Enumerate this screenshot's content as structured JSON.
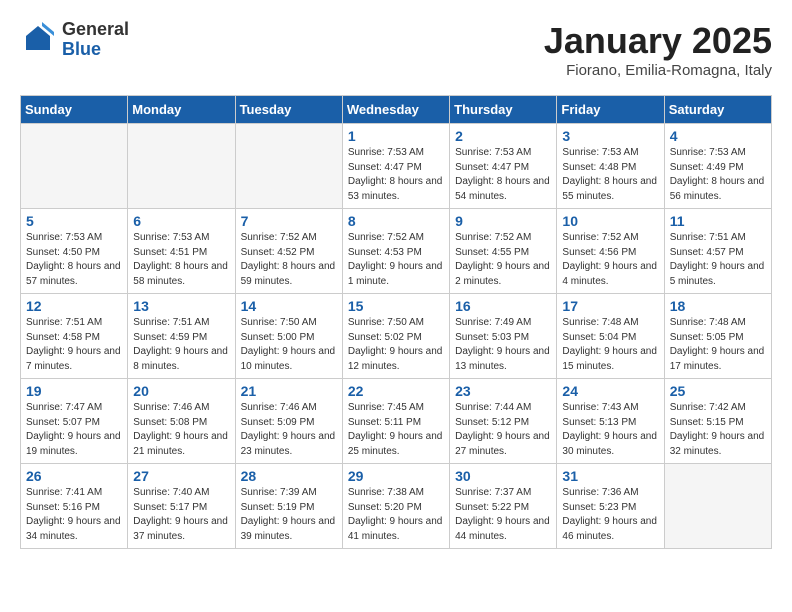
{
  "header": {
    "logo_general": "General",
    "logo_blue": "Blue",
    "title": "January 2025",
    "subtitle": "Fiorano, Emilia-Romagna, Italy"
  },
  "weekdays": [
    "Sunday",
    "Monday",
    "Tuesday",
    "Wednesday",
    "Thursday",
    "Friday",
    "Saturday"
  ],
  "weeks": [
    [
      {
        "num": "",
        "info": ""
      },
      {
        "num": "",
        "info": ""
      },
      {
        "num": "",
        "info": ""
      },
      {
        "num": "1",
        "info": "Sunrise: 7:53 AM\nSunset: 4:47 PM\nDaylight: 8 hours and 53 minutes."
      },
      {
        "num": "2",
        "info": "Sunrise: 7:53 AM\nSunset: 4:47 PM\nDaylight: 8 hours and 54 minutes."
      },
      {
        "num": "3",
        "info": "Sunrise: 7:53 AM\nSunset: 4:48 PM\nDaylight: 8 hours and 55 minutes."
      },
      {
        "num": "4",
        "info": "Sunrise: 7:53 AM\nSunset: 4:49 PM\nDaylight: 8 hours and 56 minutes."
      }
    ],
    [
      {
        "num": "5",
        "info": "Sunrise: 7:53 AM\nSunset: 4:50 PM\nDaylight: 8 hours and 57 minutes."
      },
      {
        "num": "6",
        "info": "Sunrise: 7:53 AM\nSunset: 4:51 PM\nDaylight: 8 hours and 58 minutes."
      },
      {
        "num": "7",
        "info": "Sunrise: 7:52 AM\nSunset: 4:52 PM\nDaylight: 8 hours and 59 minutes."
      },
      {
        "num": "8",
        "info": "Sunrise: 7:52 AM\nSunset: 4:53 PM\nDaylight: 9 hours and 1 minute."
      },
      {
        "num": "9",
        "info": "Sunrise: 7:52 AM\nSunset: 4:55 PM\nDaylight: 9 hours and 2 minutes."
      },
      {
        "num": "10",
        "info": "Sunrise: 7:52 AM\nSunset: 4:56 PM\nDaylight: 9 hours and 4 minutes."
      },
      {
        "num": "11",
        "info": "Sunrise: 7:51 AM\nSunset: 4:57 PM\nDaylight: 9 hours and 5 minutes."
      }
    ],
    [
      {
        "num": "12",
        "info": "Sunrise: 7:51 AM\nSunset: 4:58 PM\nDaylight: 9 hours and 7 minutes."
      },
      {
        "num": "13",
        "info": "Sunrise: 7:51 AM\nSunset: 4:59 PM\nDaylight: 9 hours and 8 minutes."
      },
      {
        "num": "14",
        "info": "Sunrise: 7:50 AM\nSunset: 5:00 PM\nDaylight: 9 hours and 10 minutes."
      },
      {
        "num": "15",
        "info": "Sunrise: 7:50 AM\nSunset: 5:02 PM\nDaylight: 9 hours and 12 minutes."
      },
      {
        "num": "16",
        "info": "Sunrise: 7:49 AM\nSunset: 5:03 PM\nDaylight: 9 hours and 13 minutes."
      },
      {
        "num": "17",
        "info": "Sunrise: 7:48 AM\nSunset: 5:04 PM\nDaylight: 9 hours and 15 minutes."
      },
      {
        "num": "18",
        "info": "Sunrise: 7:48 AM\nSunset: 5:05 PM\nDaylight: 9 hours and 17 minutes."
      }
    ],
    [
      {
        "num": "19",
        "info": "Sunrise: 7:47 AM\nSunset: 5:07 PM\nDaylight: 9 hours and 19 minutes."
      },
      {
        "num": "20",
        "info": "Sunrise: 7:46 AM\nSunset: 5:08 PM\nDaylight: 9 hours and 21 minutes."
      },
      {
        "num": "21",
        "info": "Sunrise: 7:46 AM\nSunset: 5:09 PM\nDaylight: 9 hours and 23 minutes."
      },
      {
        "num": "22",
        "info": "Sunrise: 7:45 AM\nSunset: 5:11 PM\nDaylight: 9 hours and 25 minutes."
      },
      {
        "num": "23",
        "info": "Sunrise: 7:44 AM\nSunset: 5:12 PM\nDaylight: 9 hours and 27 minutes."
      },
      {
        "num": "24",
        "info": "Sunrise: 7:43 AM\nSunset: 5:13 PM\nDaylight: 9 hours and 30 minutes."
      },
      {
        "num": "25",
        "info": "Sunrise: 7:42 AM\nSunset: 5:15 PM\nDaylight: 9 hours and 32 minutes."
      }
    ],
    [
      {
        "num": "26",
        "info": "Sunrise: 7:41 AM\nSunset: 5:16 PM\nDaylight: 9 hours and 34 minutes."
      },
      {
        "num": "27",
        "info": "Sunrise: 7:40 AM\nSunset: 5:17 PM\nDaylight: 9 hours and 37 minutes."
      },
      {
        "num": "28",
        "info": "Sunrise: 7:39 AM\nSunset: 5:19 PM\nDaylight: 9 hours and 39 minutes."
      },
      {
        "num": "29",
        "info": "Sunrise: 7:38 AM\nSunset: 5:20 PM\nDaylight: 9 hours and 41 minutes."
      },
      {
        "num": "30",
        "info": "Sunrise: 7:37 AM\nSunset: 5:22 PM\nDaylight: 9 hours and 44 minutes."
      },
      {
        "num": "31",
        "info": "Sunrise: 7:36 AM\nSunset: 5:23 PM\nDaylight: 9 hours and 46 minutes."
      },
      {
        "num": "",
        "info": ""
      }
    ]
  ]
}
